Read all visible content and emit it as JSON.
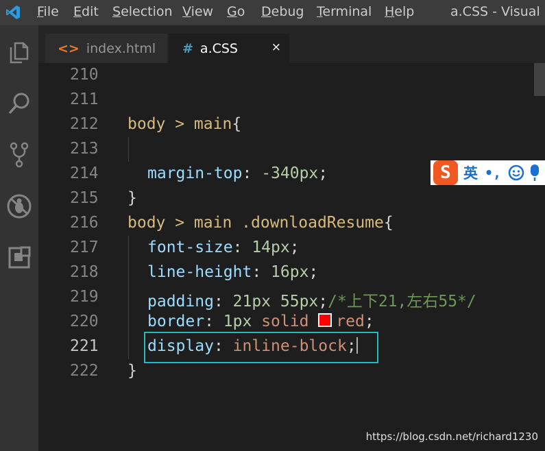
{
  "titlebar": {
    "menu": [
      {
        "accel": "F",
        "rest": "ile"
      },
      {
        "accel": "E",
        "rest": "dit"
      },
      {
        "accel": "S",
        "rest": "election"
      },
      {
        "accel": "V",
        "rest": "iew"
      },
      {
        "accel": "G",
        "rest": "o"
      },
      {
        "accel": "D",
        "rest": "ebug"
      },
      {
        "accel": "T",
        "rest": "erminal"
      },
      {
        "accel": "H",
        "rest": "elp"
      }
    ],
    "window_title": "a.CSS - Visual Stu"
  },
  "activity_bar": {
    "icons": [
      "explorer-icon",
      "search-icon",
      "source-control-icon",
      "debug-icon",
      "extensions-icon"
    ]
  },
  "tabs": [
    {
      "icon": "<>",
      "label": "index.html",
      "active": false
    },
    {
      "icon": "#",
      "label": "a.CSS",
      "active": true,
      "close": "×"
    }
  ],
  "editor": {
    "active_line": "221",
    "lines": [
      {
        "n": "210"
      },
      {
        "n": "211"
      },
      {
        "n": "212",
        "tokens": {
          "sel": "body > main",
          "punc": "{"
        }
      },
      {
        "n": "213"
      },
      {
        "n": "214",
        "tokens": {
          "prop": "margin-top",
          "colon": ": ",
          "num": "-340px",
          "end": ";"
        }
      },
      {
        "n": "215",
        "tokens": {
          "punc": "}"
        }
      },
      {
        "n": "216",
        "tokens": {
          "sel": "body > main .downloadResume",
          "punc": "{"
        }
      },
      {
        "n": "217",
        "tokens": {
          "prop": "font-size",
          "colon": ": ",
          "num": "14px",
          "end": ";"
        }
      },
      {
        "n": "218",
        "tokens": {
          "prop": "line-height",
          "colon": ": ",
          "num": "16px",
          "end": ";"
        }
      },
      {
        "n": "219",
        "tokens": {
          "prop": "padding",
          "colon": ": ",
          "num": "21px 55px",
          "end": ";",
          "comment": "/*上下21,左右55*/"
        }
      },
      {
        "n": "220",
        "tokens": {
          "prop": "border",
          "colon": ": ",
          "num": "1px",
          "val": " solid ",
          "color_val": "red",
          "end": ";"
        }
      },
      {
        "n": "221",
        "tokens": {
          "prop": "display",
          "colon": ": ",
          "val": "inline-block",
          "end": ";"
        }
      },
      {
        "n": "222",
        "tokens": {
          "punc": "}"
        }
      }
    ]
  },
  "ime": {
    "logo": "S",
    "mode": "英",
    "punct": "•,",
    "icons": [
      "emoji-icon",
      "microphone-icon"
    ]
  },
  "watermark": "https://blog.csdn.net/richard1230",
  "colors": {
    "highlight_box": "#1fbfbf",
    "swatch": "#ff0000",
    "accent": "#007acc"
  }
}
